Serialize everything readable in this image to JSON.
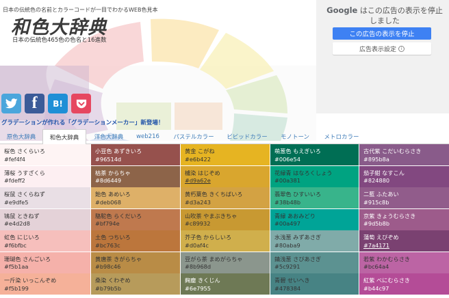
{
  "header": {
    "tagline": "日本の伝統色の名前とカラーコードが一目でわかるWEB色見本",
    "logo": "和色大辞典",
    "subtitle": "日本の伝統色465色の色名と16進数"
  },
  "social": {
    "hatena_label": "B!",
    "facebook_label": "f"
  },
  "promo": "グラデーションが作れる「グラデーションメーカー」新登場！",
  "ad": {
    "google": "Google",
    "headline": "はこの広告の表示を停止しました",
    "stop_label": "この広告の表示を停止",
    "settings_label": "広告表示設定",
    "info_glyph": "i"
  },
  "tabs": [
    {
      "label": "原色大辞典"
    },
    {
      "label": "和色大辞典"
    },
    {
      "label": "洋色大辞典"
    },
    {
      "label": "web216"
    },
    {
      "label": "パステルカラー"
    },
    {
      "label": "ビビッドカラー"
    },
    {
      "label": "モノトーン"
    },
    {
      "label": "メトロカラー"
    }
  ],
  "colors": [
    [
      {
        "name": "桜色 さくらいろ",
        "code": "#fef4f4",
        "bg": "#fef4f4",
        "fg": "#333333"
      },
      {
        "name": "薄桜 うすざくら",
        "code": "#fdeff2",
        "bg": "#fdeff2",
        "fg": "#333333"
      },
      {
        "name": "桜鼠 さくらねず",
        "code": "#e9dfe5",
        "bg": "#e9dfe5",
        "fg": "#333333"
      },
      {
        "name": "鴇鼠 ときねず",
        "code": "#e4d2d8",
        "bg": "#e4d2d8",
        "fg": "#333333"
      },
      {
        "name": "虹色 にじいろ",
        "code": "#f6bfbc",
        "bg": "#f6bfbc",
        "fg": "#333333"
      },
      {
        "name": "珊瑚色 さんごいろ",
        "code": "#f5b1aa",
        "bg": "#f5b1aa",
        "fg": "#333333"
      },
      {
        "name": "一斤染 いっこんぞめ",
        "code": "#f5b199",
        "bg": "#f5b199",
        "fg": "#333333"
      }
    ],
    [
      {
        "name": "小豆色 あずきいろ",
        "code": "#96514d",
        "bg": "#96514d",
        "fg": "#ffffff"
      },
      {
        "name": "枯茶 からちゃ",
        "code": "#8d6449",
        "bg": "#8d6449",
        "fg": "#ffffff"
      },
      {
        "name": "飴色 あめいろ",
        "code": "#deb068",
        "bg": "#deb068",
        "fg": "#333333"
      },
      {
        "name": "駱駝色 らくだいろ",
        "code": "#bf794e",
        "bg": "#bf794e",
        "fg": "#333333"
      },
      {
        "name": "土色 つちいろ",
        "code": "#bc763c",
        "bg": "#bc763c",
        "fg": "#333333"
      },
      {
        "name": "黄唐茶 きがらちゃ",
        "code": "#b98c46",
        "bg": "#b98c46",
        "fg": "#333333"
      },
      {
        "name": "桑染 くわぞめ",
        "code": "#b79b5b",
        "bg": "#b79b5b",
        "fg": "#333333"
      }
    ],
    [
      {
        "name": "黄金 こがね",
        "code": "#e6b422",
        "bg": "#e6b422",
        "fg": "#333333"
      },
      {
        "name": "櫨染 はじぞめ",
        "code": "#d9a62e",
        "bg": "#d9a62e",
        "fg": "#333333",
        "underline": true
      },
      {
        "name": "黄朽葉色 きくちばいろ",
        "code": "#d3a243",
        "bg": "#d3a243",
        "fg": "#333333"
      },
      {
        "name": "山吹茶 やまぶきちゃ",
        "code": "#c89932",
        "bg": "#c89932",
        "fg": "#333333"
      },
      {
        "name": "芥子色 からしいろ",
        "code": "#d0af4c",
        "bg": "#d0af4c",
        "fg": "#333333"
      },
      {
        "name": "豆がら茶 まめがらちゃ",
        "code": "#8b968d",
        "bg": "#8b968d",
        "fg": "#333333"
      },
      {
        "name": "麹塵 きくじん",
        "code": "#6e7955",
        "bg": "#6e7955",
        "fg": "#ffffff"
      }
    ],
    [
      {
        "name": "萌葱色 もえぎいろ",
        "code": "#006e54",
        "bg": "#006e54",
        "fg": "#ffffff"
      },
      {
        "name": "花緑青 はなろくしょう",
        "code": "#00a381",
        "bg": "#00a381",
        "fg": "#333333"
      },
      {
        "name": "翡翠色 ひすいいろ",
        "code": "#38b48b",
        "bg": "#38b48b",
        "fg": "#333333"
      },
      {
        "name": "青緑 あおみどり",
        "code": "#00a497",
        "bg": "#00a497",
        "fg": "#333333"
      },
      {
        "name": "水浅葱 みずあさぎ",
        "code": "#80aba9",
        "bg": "#80aba9",
        "fg": "#333333"
      },
      {
        "name": "錆浅葱 さびあさぎ",
        "code": "#5c9291",
        "bg": "#5c9291",
        "fg": "#333333"
      },
      {
        "name": "青碧 せいへき",
        "code": "#478384",
        "bg": "#478384",
        "fg": "#333333"
      }
    ],
    [
      {
        "name": "古代紫 こだいむらさき",
        "code": "#895b8a",
        "bg": "#895b8a",
        "fg": "#ffffff"
      },
      {
        "name": "茄子紺 なすこん",
        "code": "#824880",
        "bg": "#824880",
        "fg": "#ffffff"
      },
      {
        "name": "二藍 ふたあい",
        "code": "#915c8b",
        "bg": "#915c8b",
        "fg": "#ffffff"
      },
      {
        "name": "京紫 きょうむらさき",
        "code": "#9d5b8b",
        "bg": "#9d5b8b",
        "fg": "#ffffff"
      },
      {
        "name": "蒲萄 えびぞめ",
        "code": "#7a4171",
        "bg": "#7a4171",
        "fg": "#ffffff",
        "underline": true
      },
      {
        "name": "若紫 わかむらさき",
        "code": "#bc64a4",
        "bg": "#bc64a4",
        "fg": "#333333"
      },
      {
        "name": "紅紫 べにむらさき",
        "code": "#b44c97",
        "bg": "#b44c97",
        "fg": "#ffffff"
      }
    ]
  ]
}
